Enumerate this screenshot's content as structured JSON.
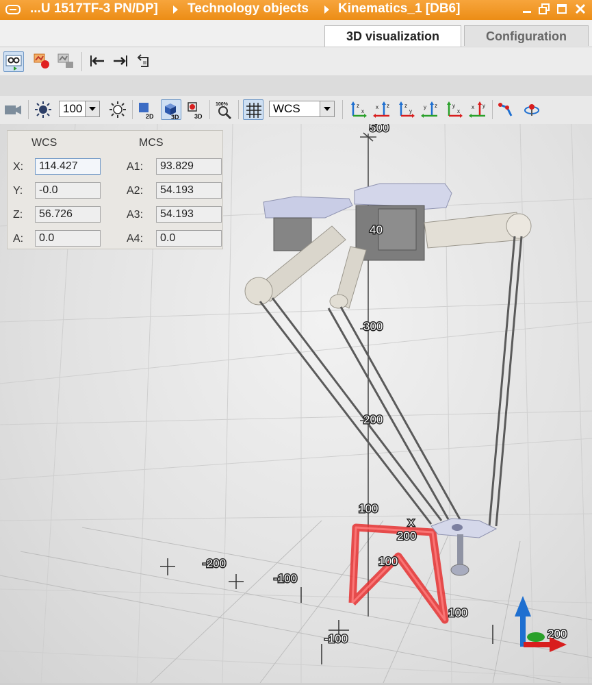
{
  "titlebar": {
    "crumb_cpu": "...U 1517TF-3 PN/DP]",
    "crumb_tech": "Technology objects",
    "crumb_kin": "Kinematics_1 [DB6]"
  },
  "tabs": [
    {
      "label": "3D visualization",
      "active": true
    },
    {
      "label": "Configuration",
      "active": false
    }
  ],
  "toolbar": {
    "zoom_value": "100",
    "zoom_fit_label": "100%",
    "coord_system": "WCS",
    "view_2d_label": "2D",
    "view_3d_label": "3D",
    "view_3d_trace_label": "3D"
  },
  "coord_panel": {
    "wcs_header": "WCS",
    "mcs_header": "MCS",
    "wcs": [
      {
        "label": "X:",
        "value": "114.427"
      },
      {
        "label": "Y:",
        "value": "-0.0"
      },
      {
        "label": "Z:",
        "value": "56.726"
      },
      {
        "label": "A:",
        "value": "0.0"
      }
    ],
    "mcs": [
      {
        "label": "A1:",
        "value": "93.829"
      },
      {
        "label": "A2:",
        "value": "54.193"
      },
      {
        "label": "A3:",
        "value": "54.193"
      },
      {
        "label": "A4:",
        "value": "0.0"
      }
    ]
  },
  "scene": {
    "axis_labels": {
      "z500": "500",
      "z400": "40",
      "z300": "300",
      "z200": "200",
      "z100": "100",
      "x_m200": "-200",
      "x_m100": "-100",
      "y_m100": "-100",
      "path_200": "200",
      "path_100a": "100",
      "path_100b": "100",
      "x_marker": "X",
      "triad_200": "200"
    }
  },
  "colors": {
    "title_orange": "#f0961e",
    "trace_red": "#e53030",
    "axis_blue": "#1e6fd0",
    "axis_red": "#d81e1e",
    "axis_green": "#2aa02a"
  }
}
